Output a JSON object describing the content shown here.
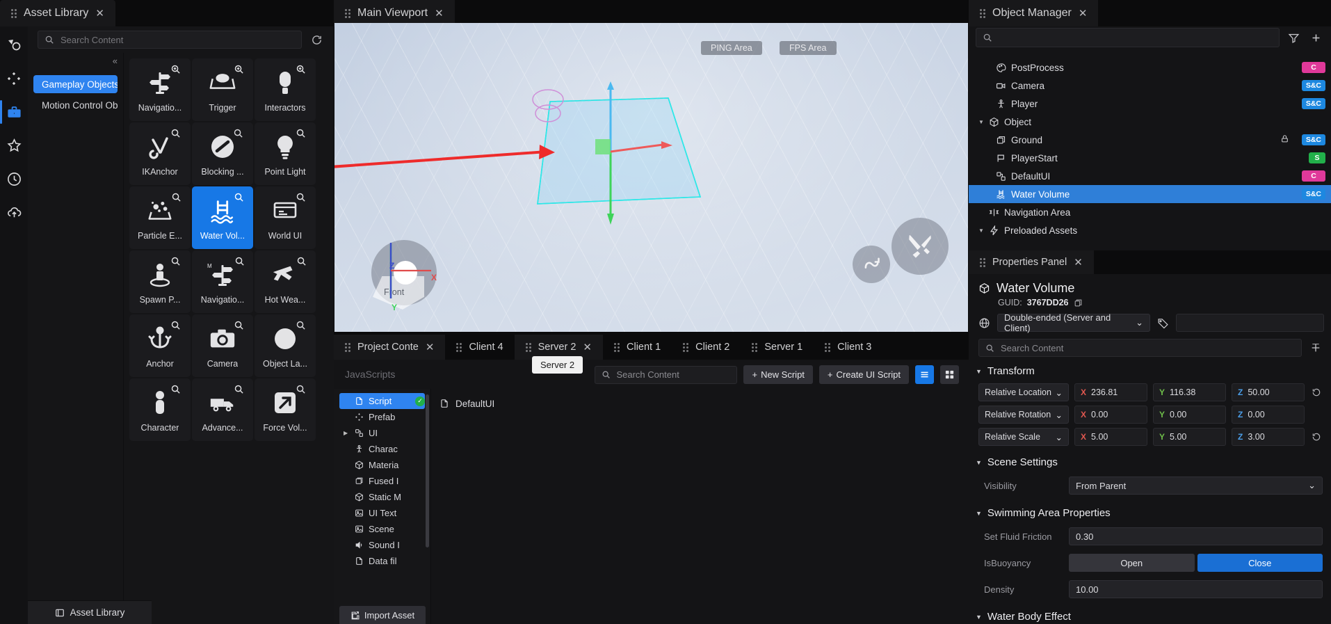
{
  "asset_library": {
    "tab_title": "Asset Library",
    "search_placeholder": "Search Content",
    "rail_icons": [
      "shapes-icon",
      "nodes-icon",
      "toolbox-icon",
      "star-icon",
      "clock-icon",
      "cloud-upload-icon"
    ],
    "collapse_label": "«",
    "categories": [
      {
        "label": "Gameplay Objects",
        "selected": true
      },
      {
        "label": "Motion Control Obj...",
        "selected": false
      }
    ],
    "assets": [
      {
        "label": "Navigatio...",
        "icon": "signpost-icon",
        "selected": false
      },
      {
        "label": "Trigger",
        "icon": "trigger-icon",
        "selected": false
      },
      {
        "label": "Interactors",
        "icon": "interactor-icon",
        "selected": false
      },
      {
        "label": "IKAnchor",
        "icon": "ikanchor-icon",
        "selected": false
      },
      {
        "label": "Blocking ...",
        "icon": "blocking-icon",
        "selected": false
      },
      {
        "label": "Point Light",
        "icon": "bulb-icon",
        "selected": false
      },
      {
        "label": "Particle E...",
        "icon": "particle-icon",
        "selected": false
      },
      {
        "label": "Water Vol...",
        "icon": "water-volume-icon",
        "selected": true
      },
      {
        "label": "World UI",
        "icon": "world-ui-icon",
        "selected": false
      },
      {
        "label": "Spawn P...",
        "icon": "spawn-point-icon",
        "selected": false
      },
      {
        "label": "Navigatio...",
        "icon": "signpost-m-icon",
        "selected": false
      },
      {
        "label": "Hot Wea...",
        "icon": "weapon-icon",
        "selected": false
      },
      {
        "label": "Anchor",
        "icon": "anchor-icon",
        "selected": false
      },
      {
        "label": "Camera",
        "icon": "camera-icon",
        "selected": false
      },
      {
        "label": "Object La...",
        "icon": "object-layer-icon",
        "selected": false
      },
      {
        "label": "Character",
        "icon": "character-icon",
        "selected": false
      },
      {
        "label": "Advance...",
        "icon": "vehicle-icon",
        "selected": false
      },
      {
        "label": "Force Vol...",
        "icon": "force-volume-icon",
        "selected": false
      }
    ],
    "footer_label": "Asset Library"
  },
  "viewport": {
    "tab_title": "Main Viewport",
    "hud": {
      "ping": "PING Area",
      "fps": "FPS Area"
    },
    "gizmo": {
      "front_label": "Front",
      "x": "X",
      "y": "Y",
      "z": "Z"
    },
    "tools": [
      "undo-curve-tool",
      "sword-tool"
    ]
  },
  "project_content": {
    "tabs": [
      {
        "label": "Project Conte",
        "active": true,
        "closable": true
      },
      {
        "label": "Client 4",
        "active": false,
        "closable": false
      },
      {
        "label": "Server 2",
        "active": true,
        "closable": true
      },
      {
        "label": "Client 1",
        "active": false,
        "closable": false
      },
      {
        "label": "Client 2",
        "active": false,
        "closable": false
      },
      {
        "label": "Server 1",
        "active": false,
        "closable": false
      },
      {
        "label": "Client 3",
        "active": false,
        "closable": false
      }
    ],
    "tooltip": "Server 2",
    "breadcrumb": "JavaScripts",
    "search_placeholder": "Search Content",
    "new_script_label": "New Script",
    "create_ui_script_label": "Create UI Script",
    "view_modes": [
      "list-view-icon",
      "grid-view-icon"
    ],
    "active_view": "list-view-icon",
    "tree": [
      {
        "label": "Script",
        "icon": "file-icon",
        "selected": true,
        "check": true,
        "caret": false
      },
      {
        "label": "Prefab",
        "icon": "prefab-icon",
        "selected": false,
        "check": false,
        "caret": false
      },
      {
        "label": "UI",
        "icon": "ui-icon",
        "selected": false,
        "check": false,
        "caret": true
      },
      {
        "label": "Charac",
        "icon": "character-icon",
        "selected": false,
        "check": false,
        "caret": false
      },
      {
        "label": "Materia",
        "icon": "material-icon",
        "selected": false,
        "check": false,
        "caret": false
      },
      {
        "label": "Fused I",
        "icon": "fused-icon",
        "selected": false,
        "check": false,
        "caret": false
      },
      {
        "label": "Static M",
        "icon": "staticmesh-icon",
        "selected": false,
        "check": false,
        "caret": false
      },
      {
        "label": "UI Text",
        "icon": "image-icon",
        "selected": false,
        "check": false,
        "caret": false
      },
      {
        "label": "Scene ",
        "icon": "image-icon",
        "selected": false,
        "check": false,
        "caret": false
      },
      {
        "label": "Sound I",
        "icon": "sound-icon",
        "selected": false,
        "check": false,
        "caret": false
      },
      {
        "label": "Data fil",
        "icon": "file-icon",
        "selected": false,
        "check": false,
        "caret": false
      }
    ],
    "import_label": "Import Asset",
    "files": [
      {
        "label": "DefaultUI",
        "icon": "file-icon"
      }
    ]
  },
  "object_manager": {
    "tab_title": "Object Manager",
    "search_placeholder": "",
    "filter_icon": "filter-icon",
    "add_icon": "plus-icon",
    "rows": [
      {
        "label": "PostProcess",
        "icon": "postprocess-icon",
        "indent": 1,
        "badge": "C",
        "badge_color": "#e0399a",
        "selected": false,
        "caret": ""
      },
      {
        "label": "Camera",
        "icon": "camera-icon",
        "indent": 1,
        "badge": "S&C",
        "badge_color": "#1d88e0",
        "selected": false,
        "caret": ""
      },
      {
        "label": "Player",
        "icon": "player-icon",
        "indent": 1,
        "badge": "S&C",
        "badge_color": "#1d88e0",
        "selected": false,
        "caret": ""
      },
      {
        "label": "Object",
        "icon": "cube-icon",
        "indent": 0,
        "badge": "",
        "badge_color": "",
        "selected": false,
        "caret": "▼"
      },
      {
        "label": "Ground",
        "icon": "ground-icon",
        "indent": 1,
        "badge": "S&C",
        "badge_color": "#1d88e0",
        "selected": false,
        "caret": "",
        "lock": true
      },
      {
        "label": "PlayerStart",
        "icon": "flag-icon",
        "indent": 1,
        "badge": "S",
        "badge_color": "#22b04a",
        "selected": false,
        "caret": ""
      },
      {
        "label": "DefaultUI",
        "icon": "ui-icon",
        "indent": 1,
        "badge": "C",
        "badge_color": "#e0399a",
        "selected": false,
        "caret": ""
      },
      {
        "label": "Water Volume",
        "icon": "water-volume-icon",
        "indent": 1,
        "badge": "S&C",
        "badge_color": "#1d88e0",
        "selected": true,
        "caret": ""
      },
      {
        "label": "Navigation Area",
        "icon": "navarea-icon",
        "indent": 0,
        "badge": "",
        "badge_color": "",
        "selected": false,
        "caret": ""
      },
      {
        "label": "Preloaded Assets",
        "icon": "bolt-icon",
        "indent": 0,
        "badge": "",
        "badge_color": "",
        "selected": false,
        "caret": "▼"
      }
    ]
  },
  "properties": {
    "tab_title": "Properties Panel",
    "object_name": "Water Volume",
    "guid_label": "GUID:",
    "guid_value": "3767DD26",
    "copy_icon": "copy-icon",
    "network_mode": "Double-ended (Server and Client)",
    "search_placeholder": "Search Content",
    "add_component_icon": "add-component-icon",
    "sections": {
      "transform": {
        "title": "Transform",
        "rows": [
          {
            "label": "Relative Location",
            "x": "236.81",
            "y": "116.38",
            "z": "50.00"
          },
          {
            "label": "Relative Rotation",
            "x": "0.00",
            "y": "0.00",
            "z": "0.00"
          },
          {
            "label": "Relative Scale",
            "x": "5.00",
            "y": "5.00",
            "z": "3.00"
          }
        ]
      },
      "scene_settings": {
        "title": "Scene Settings",
        "rows": [
          {
            "label": "Visibility",
            "value": "From Parent",
            "type": "select"
          }
        ]
      },
      "swimming": {
        "title": "Swimming Area Properties",
        "rows": [
          {
            "label": "Set Fluid Friction",
            "value": "0.30",
            "type": "input"
          },
          {
            "label": "IsBuoyancy",
            "value": "",
            "type": "segments",
            "segments": [
              "Open",
              "Close"
            ],
            "active": "Close"
          },
          {
            "label": "Density",
            "value": "10.00",
            "type": "input"
          }
        ]
      },
      "water_body": {
        "title": "Water Body Effect"
      }
    }
  },
  "colors": {
    "accent": "#2f84f0",
    "selection": "#1778e6",
    "panel_bg": "#141416",
    "badge_server_client": "#1d88e0",
    "badge_client": "#e0399a",
    "badge_server": "#22b04a",
    "anno_arrow": "#ee2b2b"
  }
}
